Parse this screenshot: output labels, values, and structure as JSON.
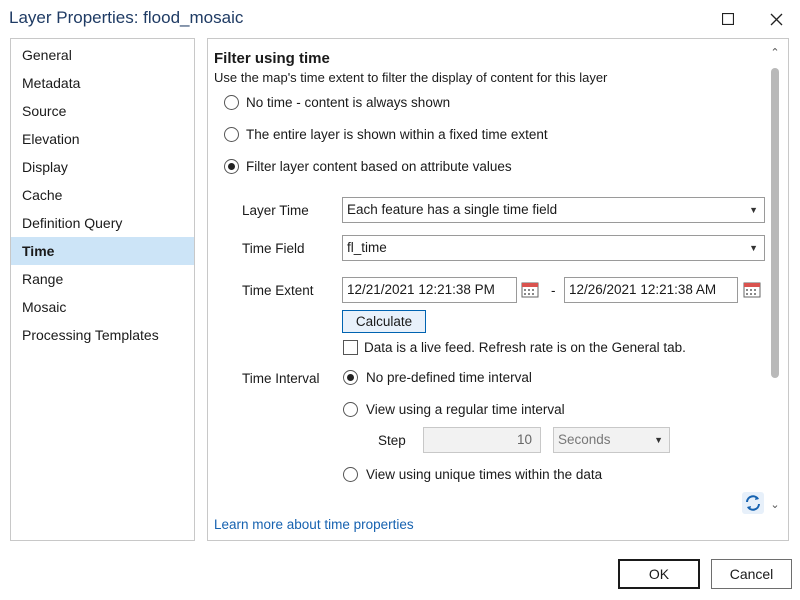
{
  "window": {
    "title": "Layer Properties: flood_mosaic"
  },
  "nav": {
    "items": [
      {
        "label": "General"
      },
      {
        "label": "Metadata"
      },
      {
        "label": "Source"
      },
      {
        "label": "Elevation"
      },
      {
        "label": "Display"
      },
      {
        "label": "Cache"
      },
      {
        "label": "Definition Query"
      },
      {
        "label": "Time",
        "selected": true
      },
      {
        "label": "Range"
      },
      {
        "label": "Mosaic"
      },
      {
        "label": "Processing Templates"
      }
    ]
  },
  "filter": {
    "title": "Filter using time",
    "description": "Use the map's time extent to filter the display of content for this layer",
    "options": [
      {
        "label": "No time - content is always shown",
        "selected": false
      },
      {
        "label": "The entire layer is shown within a fixed time extent",
        "selected": false
      },
      {
        "label": "Filter layer content based on attribute values",
        "selected": true
      }
    ]
  },
  "form": {
    "layer_time_label": "Layer Time",
    "layer_time_value": "Each feature has a single time field",
    "time_field_label": "Time Field",
    "time_field_value": "fl_time",
    "time_extent_label": "Time Extent",
    "extent_start": "12/21/2021 12:21:38 PM",
    "extent_separator": "-",
    "extent_end": "12/26/2021 12:21:38 AM",
    "calculate_label": "Calculate",
    "live_feed_label": "Data is a live feed. Refresh rate is on the General tab.",
    "live_feed_checked": false,
    "time_interval_label": "Time Interval",
    "interval_options": [
      {
        "label": "No pre-defined time interval",
        "selected": true
      },
      {
        "label": "View using a regular time interval",
        "selected": false
      },
      {
        "label": "View using unique times within the data",
        "selected": false
      }
    ],
    "step_label": "Step",
    "step_value": "10",
    "step_unit": "Seconds"
  },
  "learn_more": "Learn more about time properties",
  "footer": {
    "ok_label": "OK",
    "cancel_label": "Cancel"
  },
  "icons": {
    "maximize": "maximize-icon",
    "close": "close-icon",
    "calendar": "calendar-icon",
    "refresh": "refresh-icon"
  },
  "colors": {
    "nav_selected": "#cce4f7",
    "link": "#1662b0",
    "title": "#1f3b64"
  }
}
